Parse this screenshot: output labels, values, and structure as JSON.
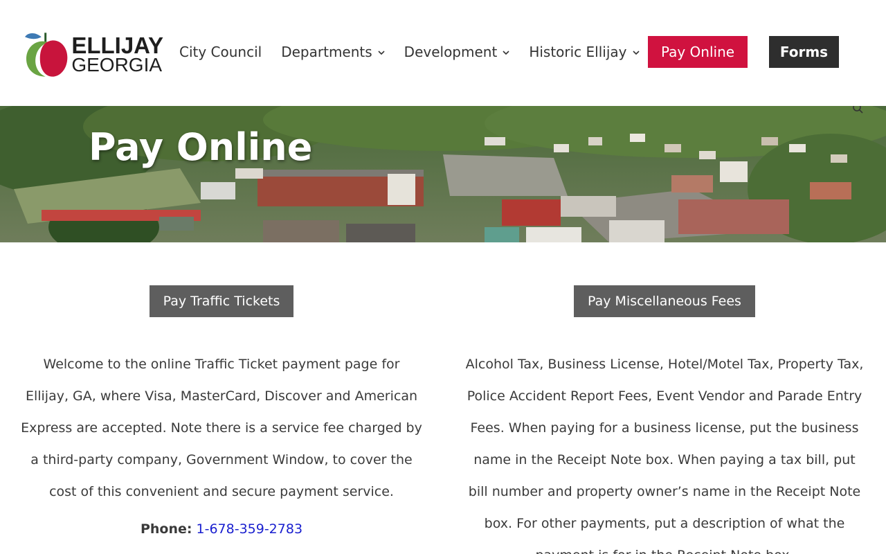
{
  "logo": {
    "line1": "ELLIJAY",
    "line2": "GEORGIA",
    "colors": {
      "apple_red": "#c8143c",
      "leaf_blue": "#3e7ab4",
      "leaf_green": "#6aa443"
    }
  },
  "nav": {
    "items": [
      {
        "label": "City Council",
        "has_dropdown": false
      },
      {
        "label": "Departments",
        "has_dropdown": true
      },
      {
        "label": "Development",
        "has_dropdown": true
      },
      {
        "label": "Historic Ellijay",
        "has_dropdown": true
      }
    ],
    "chevron": "⌄",
    "pay_online": "Pay Online",
    "forms": "Forms"
  },
  "hero": {
    "title": "Pay Online"
  },
  "left": {
    "button": "Pay Traffic Tickets",
    "text": "Welcome to the online Traffic Ticket payment page for Ellijay, GA, where Visa, MasterCard, Discover and American Express are accepted. Note there is a service fee charged by a third-party company, Government Window, to cover the cost of this convenient and secure payment service.",
    "phone_label": "Phone:",
    "phone_number": "1-678-359-2783"
  },
  "right": {
    "button": "Pay Miscellaneous Fees",
    "text": "Alcohol Tax, Business License, Hotel/Motel Tax, Property Tax, Police Accident Report Fees, Event Vendor and Parade Entry Fees. When paying for a business license, put the business name in the Receipt Note box. When paying a tax bill, put bill number and property owner’s name in the Receipt Note box. For other payments, put a description of what the payment is for in the Receipt Note box."
  },
  "colors": {
    "accent_red": "#d0123f",
    "dark_button": "#2e2e2e",
    "section_button": "#5e5e5e",
    "link_blue": "#1a20cf"
  }
}
